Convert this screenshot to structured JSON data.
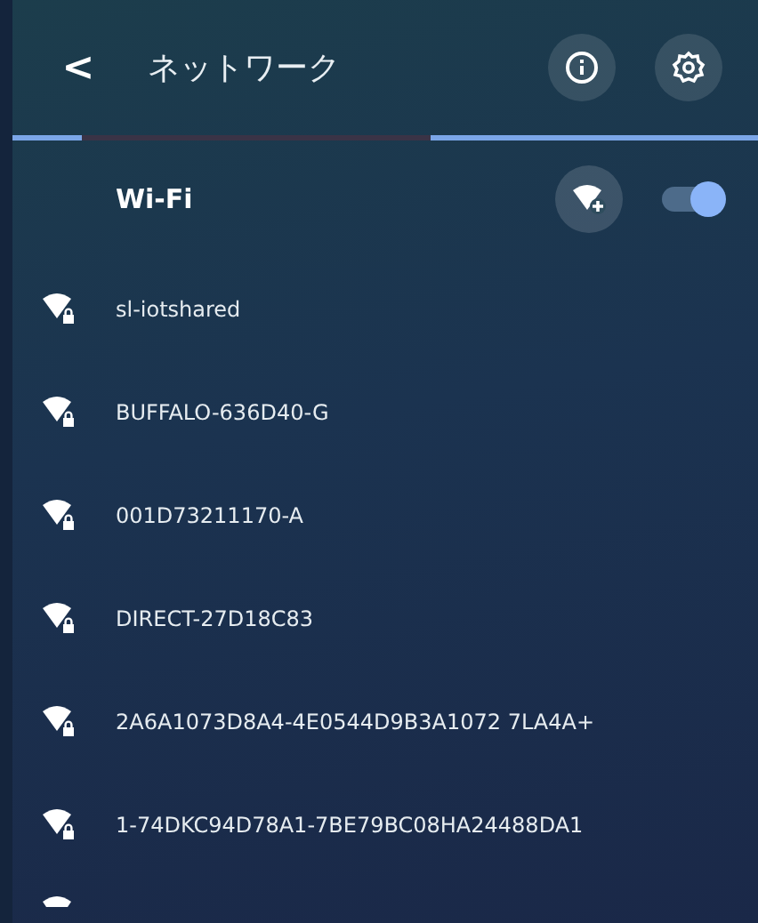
{
  "header": {
    "back": "<",
    "title": "ネットワーク"
  },
  "wifi": {
    "label": "Wi-Fi",
    "on": true
  },
  "networks": [
    {
      "name": "sl-iotshared",
      "secured": true
    },
    {
      "name": "BUFFALO-636D40-G",
      "secured": true
    },
    {
      "name": "001D73211170-A",
      "secured": true
    },
    {
      "name": "DIRECT-27D18C83",
      "secured": true
    },
    {
      "name": "2A6A1073D8A4-4E0544D9B3A1072 7LA4A+",
      "secured": true
    },
    {
      "name": "1-74DKC94D78A1-7BE79BC08HA24488DA1",
      "secured": true
    }
  ]
}
